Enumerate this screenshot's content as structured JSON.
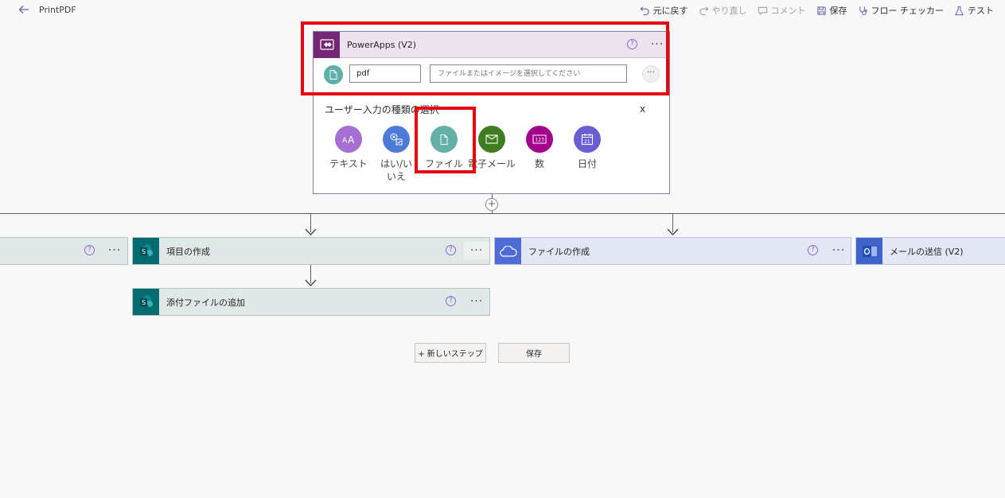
{
  "topbar": {
    "title": "PrintPDF",
    "commands": {
      "undo": "元に戻す",
      "redo": "やり直し",
      "comment": "コメント",
      "save": "保存",
      "checker": "フロー チェッカー",
      "test": "テスト"
    }
  },
  "trigger": {
    "title": "PowerApps (V2)",
    "help": "?",
    "more": "···",
    "param_name": "pdf",
    "param_placeholder": "ファイルまたはイメージを選択してください",
    "param_more": "···",
    "chooser_title": "ユーザー入力の種類の選択",
    "chooser_close": "x",
    "types": [
      {
        "label": "テキスト",
        "color": "#a66fd4"
      },
      {
        "label": "はい/いいえ",
        "color": "#4d79d8"
      },
      {
        "label": "ファイル",
        "color": "#64b0a8"
      },
      {
        "label": "電子メール",
        "color": "#3f7d20"
      },
      {
        "label": "数",
        "color": "#a3008c"
      },
      {
        "label": "日付",
        "color": "#6b5dd3"
      }
    ]
  },
  "actions": {
    "create_item": "項目の作成",
    "add_attachment": "添付ファイルの追加",
    "create_file": "ファイルの作成",
    "send_email": "メールの送信 (V2)",
    "help": "?",
    "more": "···"
  },
  "buttons": {
    "new_step": "+ 新しいステップ",
    "save": "保存"
  },
  "colors": {
    "highlight": "#e8000b",
    "powerapps": "#742774",
    "sharepoint": "#036c70",
    "onedrive": "#4f6bd8",
    "outlook": "#3f63c8"
  }
}
